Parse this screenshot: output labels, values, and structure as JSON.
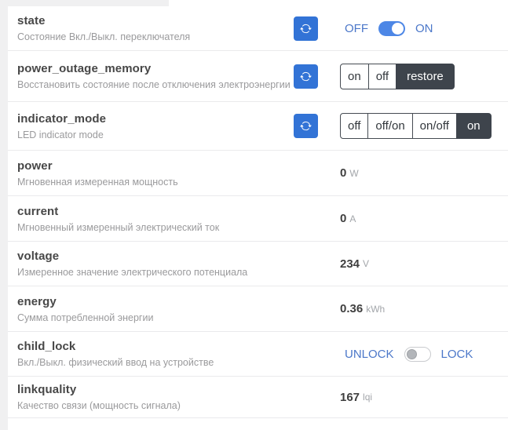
{
  "colors": {
    "refresh_button": "#3273d6",
    "toggle_on": "#4d87e6",
    "selected_option_bg": "#3e444c",
    "switch_label_blue": "#4b77c9"
  },
  "icons": {
    "refresh": "refresh-icon"
  },
  "rows": [
    {
      "name": "state",
      "description": "Состояние Вкл./Выкл. переключателя",
      "type": "toggle",
      "refresh": true,
      "off_label": "OFF",
      "on_label": "ON",
      "state": "on"
    },
    {
      "name": "power_outage_memory",
      "description": "Восстановить состояние после отключения электроэнергии",
      "type": "buttons",
      "refresh": true,
      "options": [
        "on",
        "off",
        "restore"
      ],
      "selected": "restore"
    },
    {
      "name": "indicator_mode",
      "description": "LED indicator mode",
      "type": "buttons",
      "refresh": true,
      "options": [
        "off",
        "off/on",
        "on/off",
        "on"
      ],
      "selected": "on"
    },
    {
      "name": "power",
      "description": "Мгновенная измеренная мощность",
      "type": "value",
      "value": "0",
      "unit": "W"
    },
    {
      "name": "current",
      "description": "Мгновенный измеренный электрический ток",
      "type": "value",
      "value": "0",
      "unit": "A"
    },
    {
      "name": "voltage",
      "description": "Измеренное значение электрического потенциала",
      "type": "value",
      "value": "234",
      "unit": "V"
    },
    {
      "name": "energy",
      "description": "Сумма потребленной энергии",
      "type": "value",
      "value": "0.36",
      "unit": "kWh"
    },
    {
      "name": "child_lock",
      "description": "Вкл./Выкл. физический ввод на устройстве",
      "type": "toggle",
      "refresh": false,
      "off_label": "UNLOCK",
      "on_label": "LOCK",
      "state": "off"
    },
    {
      "name": "linkquality",
      "description": "Качество связи (мощность сигнала)",
      "type": "value",
      "value": "167",
      "unit": "lqi"
    }
  ]
}
